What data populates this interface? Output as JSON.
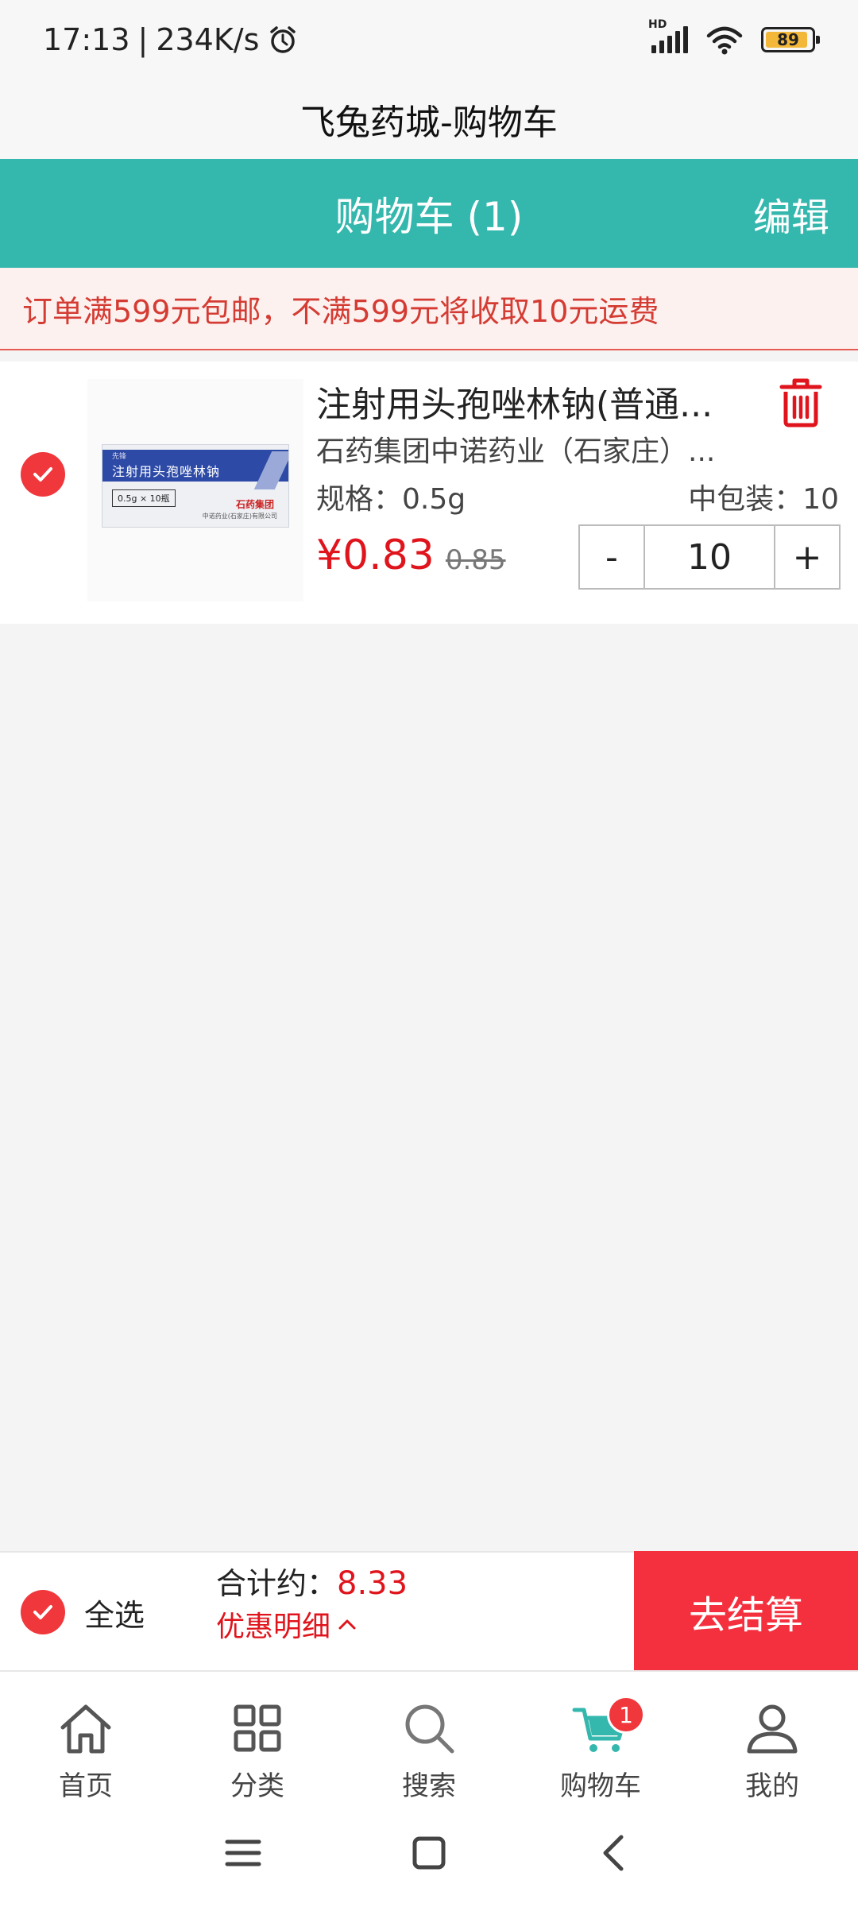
{
  "status_bar": {
    "time": "17:13",
    "net_speed": "234K/s",
    "battery": "89",
    "hd": "HD"
  },
  "app_title": "飞兔药城-购物车",
  "header": {
    "title": "购物车 (1)",
    "edit_label": "编辑"
  },
  "notice": "订单满599元包邮，不满599元将收取10元运费",
  "cart": {
    "items": [
      {
        "name": "注射用头孢唑林钠(普通...",
        "manufacturer": "石药集团中诺药业（石家庄）...",
        "spec": "规格：0.5g",
        "pack": "中包装：10",
        "price": "¥0.83",
        "original_price": "0.85",
        "quantity": "10",
        "minus": "-",
        "plus": "+",
        "image": {
          "brand": "先锋",
          "name": "注射用头孢唑林钠",
          "spec": "0.5g × 10瓶",
          "maker": "石药集团",
          "maker_sub": "中诺药业(石家庄)有限公司"
        }
      }
    ]
  },
  "checkout": {
    "select_all": "全选",
    "total_label": "合计约：",
    "total_amount": "8.33",
    "discount_label": "优惠明细",
    "checkout_label": "去结算"
  },
  "tabs": [
    {
      "label": "首页",
      "icon": "home-icon"
    },
    {
      "label": "分类",
      "icon": "grid-icon"
    },
    {
      "label": "搜索",
      "icon": "search-icon"
    },
    {
      "label": "购物车",
      "icon": "cart-icon",
      "badge": "1"
    },
    {
      "label": "我的",
      "icon": "user-icon"
    }
  ],
  "colors": {
    "teal": "#34b7ad",
    "red": "#f5303e",
    "price_red": "#e0141c"
  }
}
